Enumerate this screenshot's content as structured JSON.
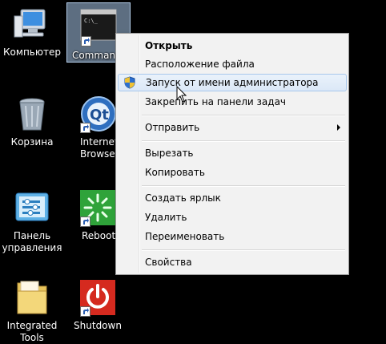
{
  "desktop": {
    "icons": [
      {
        "label": "Компьютер",
        "icon": "computer-icon"
      },
      {
        "label": "Comman",
        "icon": "command-prompt-icon"
      },
      {
        "label": "Корзина",
        "icon": "recycle-bin-icon"
      },
      {
        "label": "Internet\nBrowser",
        "icon": "quicktime-browser-icon"
      },
      {
        "label": "Панель\nуправления",
        "icon": "control-panel-icon"
      },
      {
        "label": "Reboot",
        "icon": "reboot-icon"
      },
      {
        "label": "Integrated\nTools",
        "icon": "folder-icon"
      },
      {
        "label": "Shutdown",
        "icon": "shutdown-icon"
      }
    ]
  },
  "context_menu": {
    "open": "Открыть",
    "file_location": "Расположение файла",
    "run_as_admin": "Запуск от имени администратора",
    "pin_taskbar": "Закрепить на панели задач",
    "send_to": "Отправить",
    "cut": "Вырезать",
    "copy": "Копировать",
    "create_shortcut": "Создать ярлык",
    "delete": "Удалить",
    "rename": "Переименовать",
    "properties": "Свойства"
  },
  "colors": {
    "highlight": "#dbe8f7",
    "menu_bg": "#f2f2f2"
  }
}
